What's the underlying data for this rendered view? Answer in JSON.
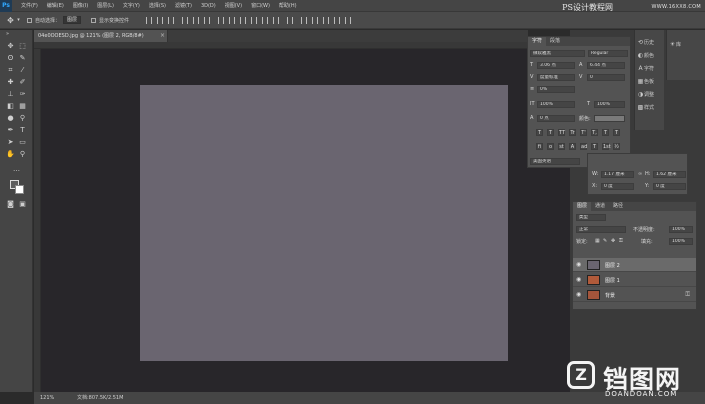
{
  "app": {
    "logo": "Ps",
    "menus": [
      "文件(F)",
      "编辑(E)",
      "图像(I)",
      "图层(L)",
      "文字(Y)",
      "选择(S)",
      "滤镜(T)",
      "3D(D)",
      "视图(V)",
      "窗口(W)",
      "帮助(H)"
    ]
  },
  "watermark_top": {
    "text": "PS设计教程网",
    "url": "WWW.16XX8.COM"
  },
  "options": {
    "auto_select_label": "自动选择：",
    "auto_select_value": "图层",
    "show_transform_label": "显示变换控件",
    "more_icon": "more-icon"
  },
  "document": {
    "tab_title": "04e0OOESD.jpg @ 121% (图层 2, RGB/8#)",
    "close_label": "×",
    "canvas_color": "#6a6570"
  },
  "status": {
    "zoom": "121%",
    "doc_info": "文档:807.5K/2.51M"
  },
  "history": {
    "items": [
      {
        "icon": "history-icon",
        "label": "历史"
      },
      {
        "icon": "color-icon",
        "label": "颜色"
      },
      {
        "icon": "character-icon",
        "label": "字符"
      },
      {
        "icon": "swatches-icon",
        "label": "色板"
      },
      {
        "icon": "adjustments-icon",
        "label": "调整"
      },
      {
        "icon": "styles-icon",
        "label": "样式"
      }
    ]
  },
  "libraries": {
    "label": "库"
  },
  "character": {
    "tabs": [
      "字符",
      "段落"
    ],
    "font_family": "微软雅黑",
    "font_style": "Regular",
    "font_size": "3.06 点",
    "leading": "6.44 点",
    "kerning": "度量标准",
    "tracking": "0",
    "scale_v": "0%",
    "scale_h": "100%",
    "scale_v2": "100%",
    "baseline": "0 点",
    "color_label": "颜色:",
    "language": "美国英语",
    "sharp": "锐利",
    "style_buttons": [
      "T",
      "T",
      "TT",
      "Tr",
      "T'",
      "T,",
      "T",
      "T"
    ],
    "alt_buttons": [
      "fi",
      "o",
      "st",
      "A",
      "ad",
      "T",
      "1st",
      "½"
    ]
  },
  "transform": {
    "w_label": "W:",
    "w_value": "1.17 厘米",
    "h_label": "H:",
    "h_value": "1.62 厘米",
    "x_label": "X:",
    "x_value": "0 度",
    "y_label": "Y:",
    "y_value": "0 度"
  },
  "layers": {
    "tabs": [
      "图层",
      "通道",
      "路径"
    ],
    "filter_kind": "类型",
    "blend_mode": "正常",
    "opacity_label": "不透明度:",
    "opacity_value": "100%",
    "lock_label": "锁定:",
    "fill_label": "填充:",
    "fill_value": "100%",
    "items": [
      {
        "name": "图层 2",
        "selected": true,
        "thumb_color": "#6a6570"
      },
      {
        "name": "图层 1",
        "selected": false,
        "thumb_color": "#b05a3a"
      },
      {
        "name": "背景",
        "selected": false,
        "thumb_color": "#a4553b"
      }
    ]
  },
  "watermark_bottom": {
    "icon": "Z",
    "text": "铛图网",
    "url": "DOANDOAN.COM"
  }
}
